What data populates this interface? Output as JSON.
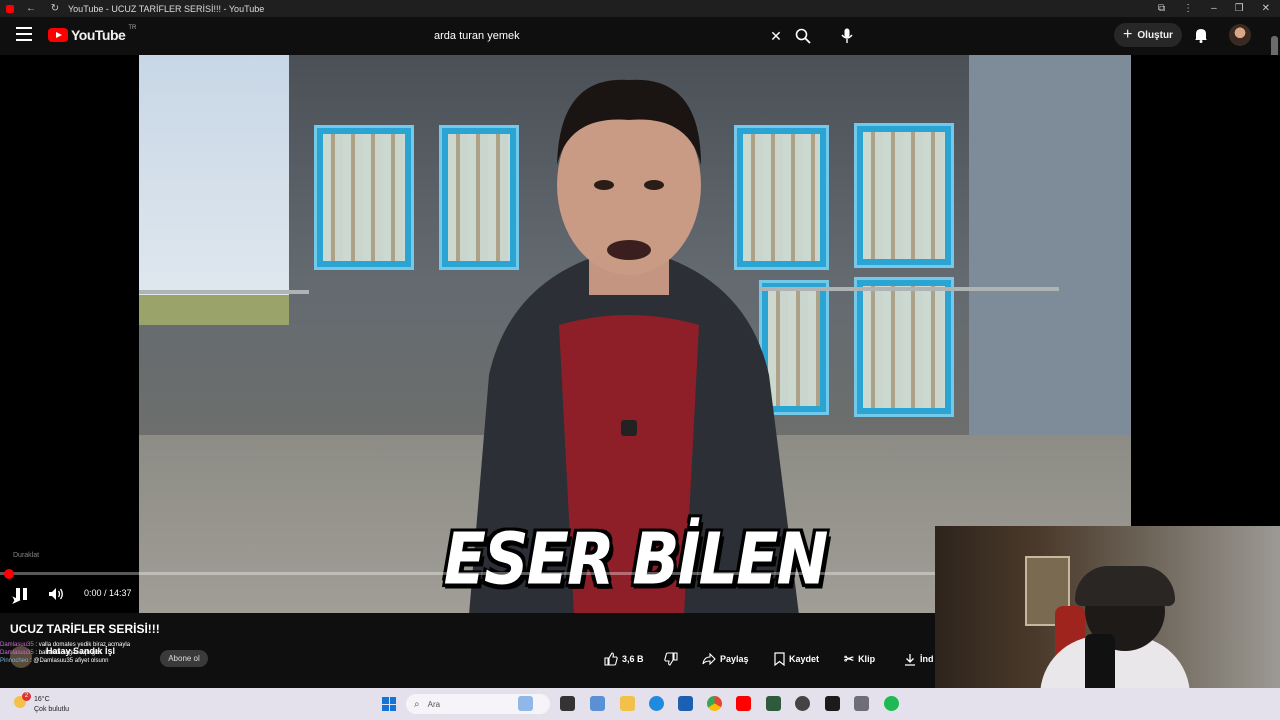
{
  "browser": {
    "tab_title": "YouTube - UCUZ TARİFLER SERİSİ!!! - YouTube"
  },
  "masthead": {
    "logo_text": "YouTube",
    "country_code": "TR",
    "search_value": "arda turan yemek",
    "create_label": "Oluştur"
  },
  "player": {
    "subtitle": "ESER BİLEN",
    "time": "0:00 / 14:37",
    "progress_fraction": 0.0,
    "paused_label": "Duraklat"
  },
  "video": {
    "title": "UCUZ TARİFLER SERİSİ!!!",
    "channel_name": "Hatay Sandık İşl",
    "subscribe_label": "Abone ol",
    "like_count": "3,6 B",
    "share_label": "Paylaş",
    "save_label": "Kaydet",
    "clip_label": "Klip",
    "download_label": "İnd"
  },
  "chat": [
    {
      "user": "Damlasuu35",
      "message": ": valla domates yedik biraz acmayla"
    },
    {
      "user": "Damlasuu35",
      "message": ": baharatı soğan açtı gibi"
    },
    {
      "user": "Pinnocheo",
      "message": ": @Damlasuu35 afiyet olsunn"
    }
  ],
  "taskbar": {
    "weather_temp": "16°C",
    "weather_desc": "Çok bulutlu",
    "weather_badge": "2",
    "search_placeholder": "Ara"
  },
  "colors": {
    "brand_red": "#ff0000",
    "background": "#0f0f0f",
    "taskbar": "#e4e0ec"
  }
}
